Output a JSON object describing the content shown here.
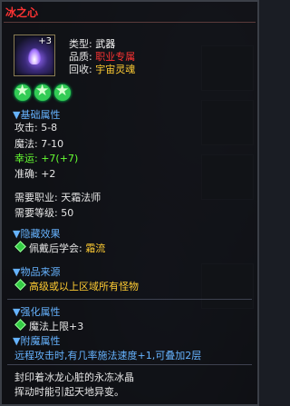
{
  "title": "冰之心",
  "item": {
    "enhance": "+3",
    "type_label": "类型:",
    "type_value": "武器",
    "quality_label": "品质:",
    "quality_value": "职业专属",
    "recycle_label": "回收:",
    "recycle_value": "宇宙灵魂"
  },
  "stars": {
    "count": 3,
    "icon": "green-star-icon",
    "color": "#33cc55"
  },
  "basic": {
    "header": "▼基础属性",
    "attack": "攻击: 5-8",
    "magic": "魔法: 7-10",
    "luck_label": "幸运:",
    "luck_value": "+7(+7)",
    "accuracy": "准确: +2"
  },
  "requirements": {
    "job": "需要职业: 天霜法师",
    "level": "需要等级: 50"
  },
  "hidden": {
    "header": "▼隐藏效果",
    "label": "佩戴后学会:",
    "value": "霜流"
  },
  "source": {
    "header": "▼物品来源",
    "value": "高级或以上区域所有怪物"
  },
  "enhance": {
    "header": "▼强化属性",
    "value": "魔法上限+3"
  },
  "enchant": {
    "header": "▼附魔属性",
    "value": "远程攻击时,有几率施法速度+1,可叠加2层"
  },
  "description": {
    "line1": "封印着冰龙心脏的永冻冰晶",
    "line2": "挥动时能引起天地异变。"
  },
  "colors": {
    "title": "#ff3333",
    "section": "#66b3ff",
    "green": "#66ff33",
    "gold": "#ffcc33"
  }
}
